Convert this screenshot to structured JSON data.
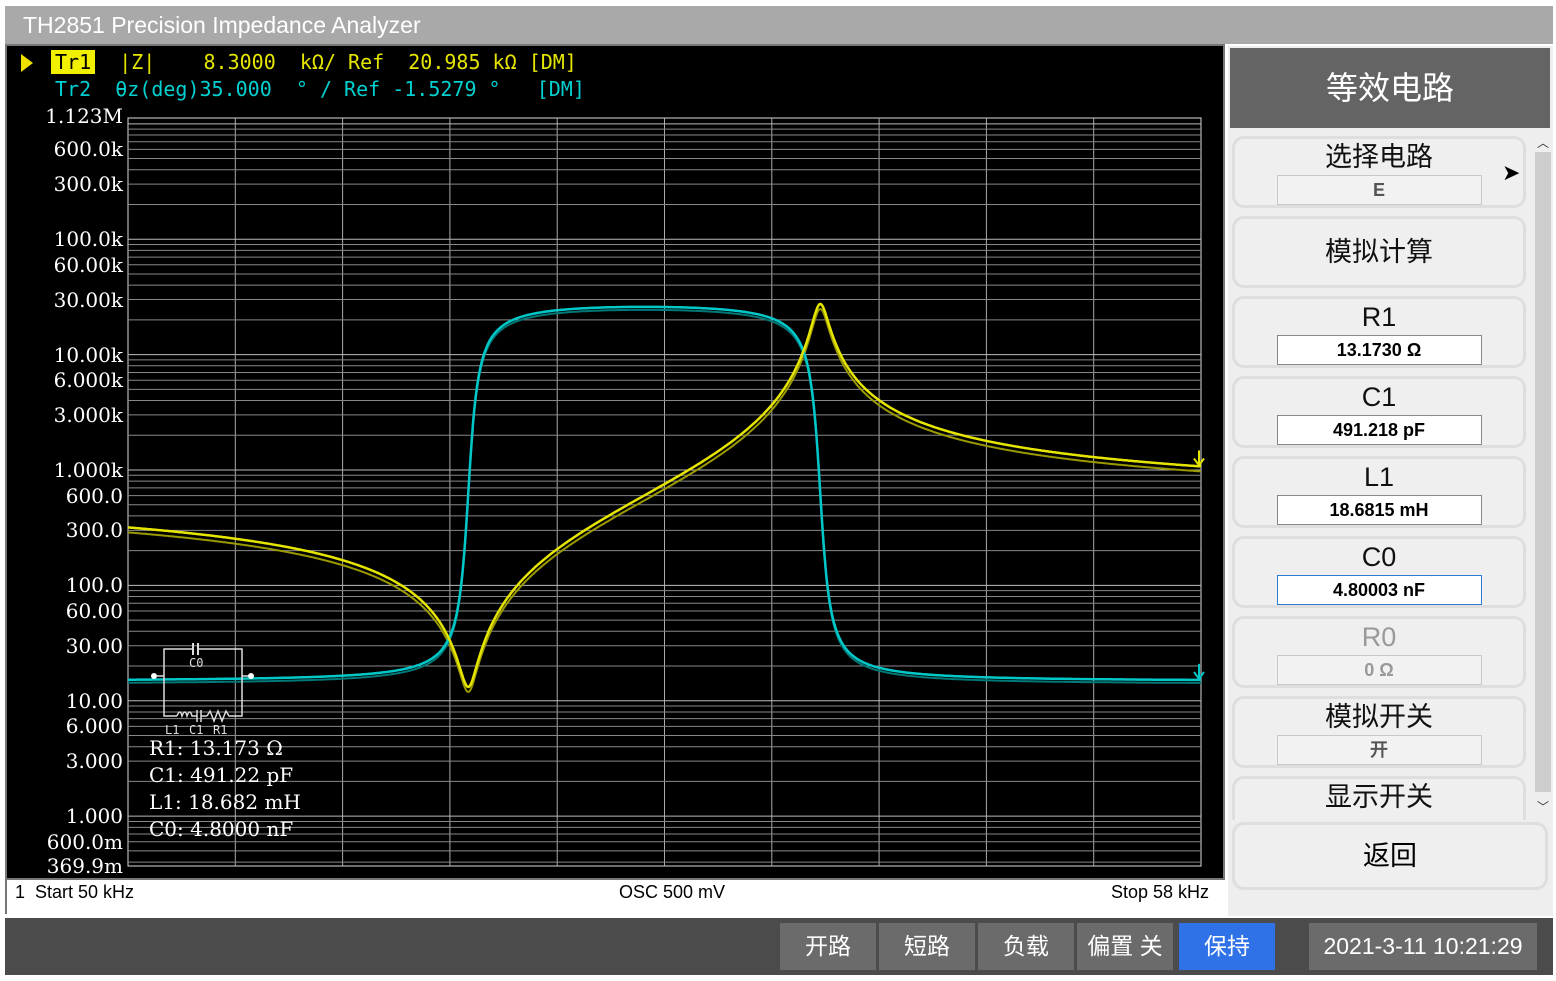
{
  "window_title": "TH2851 Precision Impedance Analyzer",
  "traces": {
    "tr1": {
      "name": "Tr1",
      "param": "|Z|",
      "scale": "8.3000",
      "scale_unit": "kΩ/",
      "ref_label": "Ref",
      "ref": "20.985",
      "ref_unit": "kΩ",
      "mode": "[DM]",
      "color": "#e5e500"
    },
    "tr2": {
      "name": "Tr2",
      "param": "θz(deg)",
      "scale": "35.000",
      "scale_unit": "° /",
      "ref_label": "Ref",
      "ref": "-1.5279",
      "ref_unit": "°",
      "mode": "[DM]",
      "color": "#00c8c8"
    }
  },
  "chart_data": {
    "type": "line",
    "x_axis": {
      "scale": "linear",
      "start_hz": 50000,
      "stop_hz": 58000,
      "divisions": 10
    },
    "y_axis": {
      "scale": "log",
      "top": "1.123M",
      "bottom": "369.9m",
      "top_value": 1123000,
      "bottom_value": 0.3699,
      "tick_labels": [
        {
          "label": "1.123M",
          "value": 1123000
        },
        {
          "label": "600.0k",
          "value": 600000
        },
        {
          "label": "300.0k",
          "value": 300000
        },
        {
          "label": "100.0k",
          "value": 100000
        },
        {
          "label": "60.00k",
          "value": 60000
        },
        {
          "label": "30.00k",
          "value": 30000
        },
        {
          "label": "10.00k",
          "value": 10000
        },
        {
          "label": "6.000k",
          "value": 6000
        },
        {
          "label": "3.000k",
          "value": 3000
        },
        {
          "label": "1.000k",
          "value": 1000
        },
        {
          "label": "600.0",
          "value": 600
        },
        {
          "label": "300.0",
          "value": 300
        },
        {
          "label": "100.0",
          "value": 100
        },
        {
          "label": "60.00",
          "value": 60
        },
        {
          "label": "30.00",
          "value": 30
        },
        {
          "label": "10.00",
          "value": 10
        },
        {
          "label": "6.000",
          "value": 6
        },
        {
          "label": "3.000",
          "value": 3
        },
        {
          "label": "1.000",
          "value": 1
        },
        {
          "label": "600.0m",
          "value": 0.6
        },
        {
          "label": "369.9m",
          "value": 0.3699
        }
      ]
    },
    "grid": true,
    "series": [
      {
        "name": "Tr1",
        "quantity": "|Z|",
        "unit": "Ω",
        "model": "equivalent-circuit E"
      },
      {
        "name": "Tr2",
        "quantity": "θz",
        "unit": "deg",
        "scale_per_div": 35,
        "ref": -1.5279
      }
    ]
  },
  "circuit": {
    "labels": {
      "c0": "C0",
      "l1": "L1",
      "c1": "C1",
      "r1": "R1"
    },
    "R1": 13.173,
    "C1": 4.9122e-10,
    "L1": 0.018682,
    "C0": 4.8e-09
  },
  "overlay_params": [
    "R1: 13.173 Ω",
    "C1: 491.22 pF",
    "L1: 18.682 mH",
    "C0: 4.8000 nF"
  ],
  "status": {
    "channel": "1",
    "start": "Start  50 kHz",
    "osc": "OSC 500 mV",
    "stop": "Stop  58 kHz"
  },
  "panel": {
    "title": "等效电路",
    "items": [
      {
        "label": "选择电路",
        "value": "E"
      },
      {
        "label": "模拟计算"
      },
      {
        "label": "R1",
        "value": "13.1730 Ω"
      },
      {
        "label": "C1",
        "value": "491.218 pF"
      },
      {
        "label": "L1",
        "value": "18.6815 mH"
      },
      {
        "label": "C0",
        "value": "4.80003 nF"
      },
      {
        "label": "R0",
        "value": "0 Ω"
      },
      {
        "label": "模拟开关",
        "value": "开"
      },
      {
        "label": "显示开关"
      }
    ],
    "back": "返回"
  },
  "bottom": {
    "buttons": [
      "开路",
      "短路",
      "负载",
      "偏置 关",
      "保持"
    ],
    "active": "保持",
    "datetime": "2021-3-11 10:21:29"
  }
}
